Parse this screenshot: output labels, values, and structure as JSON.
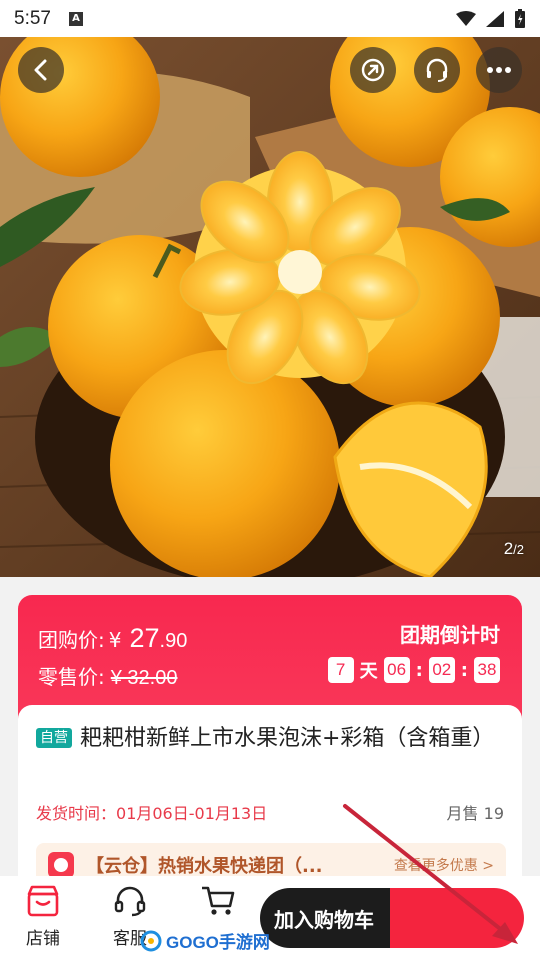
{
  "status_bar": {
    "time": "5:57",
    "notification_icon": "A"
  },
  "hero": {
    "pager_current": "2",
    "pager_total": "/2",
    "buttons": [
      "back-icon",
      "share-icon",
      "headset-icon",
      "more-icon"
    ]
  },
  "price": {
    "group_label": "团购价:",
    "currency": "¥",
    "group_price_int": "27",
    "group_price_dec": ".90",
    "retail_label": "零售价:",
    "retail_price": "¥ 32.00"
  },
  "countdown": {
    "title": "团期倒计时",
    "days": "7",
    "day_unit": "天",
    "hours": "06",
    "sep1": ":",
    "minutes": "02",
    "sep2": ":",
    "seconds": "38"
  },
  "product": {
    "tag": "自营",
    "title": "耙耙柑新鲜上市水果泡沫+彩箱（含箱重）",
    "ship_label": "发货时间：",
    "ship_range": "01月06日-01月13日",
    "sold": "月售 19"
  },
  "promo": {
    "text": "【云仓】热销水果快递团（...",
    "more": "查看更多优惠 >"
  },
  "bottom_bar": {
    "store_label": "店铺",
    "service_label": "客服",
    "add_to_cart": "加入购物车"
  },
  "watermark": {
    "text": "GOGO手游网"
  },
  "colors": {
    "accent": "#f52a52",
    "dark_button": "#1c1c1c",
    "tag_green": "#12a89d"
  }
}
